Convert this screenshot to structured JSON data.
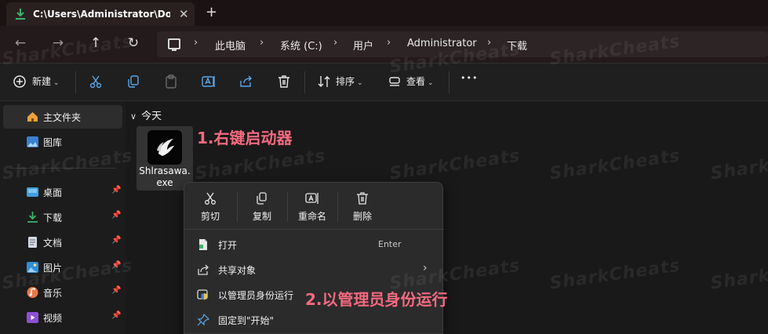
{
  "window": {
    "tab_title": "C:\\Users\\Administrator\\Downl",
    "tab_close": "✕",
    "new_tab": "+"
  },
  "nav": {
    "back": "←",
    "forward": "→",
    "up": "↑",
    "refresh": "↻",
    "separator": "›",
    "breadcrumbs": [
      "此电脑",
      "系统 (C:)",
      "用户",
      "Administrator",
      "下载"
    ]
  },
  "toolbar": {
    "new_label": "新建",
    "sort_label": "排序",
    "view_label": "查看",
    "more": "•••",
    "chevron": "⌄"
  },
  "sidebar": {
    "pin": "📌",
    "items": [
      {
        "label": "主文件夹",
        "active": true
      },
      {
        "label": "图库"
      },
      {
        "label": "桌面",
        "pinned": true
      },
      {
        "label": "下载",
        "pinned": true
      },
      {
        "label": "文档",
        "pinned": true
      },
      {
        "label": "图片",
        "pinned": true
      },
      {
        "label": "音乐",
        "pinned": true
      },
      {
        "label": "视频",
        "pinned": true
      }
    ]
  },
  "content": {
    "group_chevron": "∨",
    "group_label": "今天",
    "file": {
      "name_line1": "Shlrasawa.",
      "name_line2": "exe"
    },
    "annotation_1": "1.右键启动器",
    "annotation_2": "2.以管理员身份运行"
  },
  "context_menu": {
    "quick_actions": [
      "剪切",
      "复制",
      "重命名",
      "删除"
    ],
    "rows": [
      {
        "label": "打开",
        "shortcut": "Enter"
      },
      {
        "label": "共享对象",
        "arrow": "›"
      },
      {
        "label": "以管理员身份运行"
      },
      {
        "label": "固定到\"开始\""
      }
    ]
  },
  "watermark": "SharkCheats",
  "colors": {
    "accent_annotation": "#f46a80",
    "download_green": "#3bb56c",
    "link_blue": "#5aa7e8"
  }
}
